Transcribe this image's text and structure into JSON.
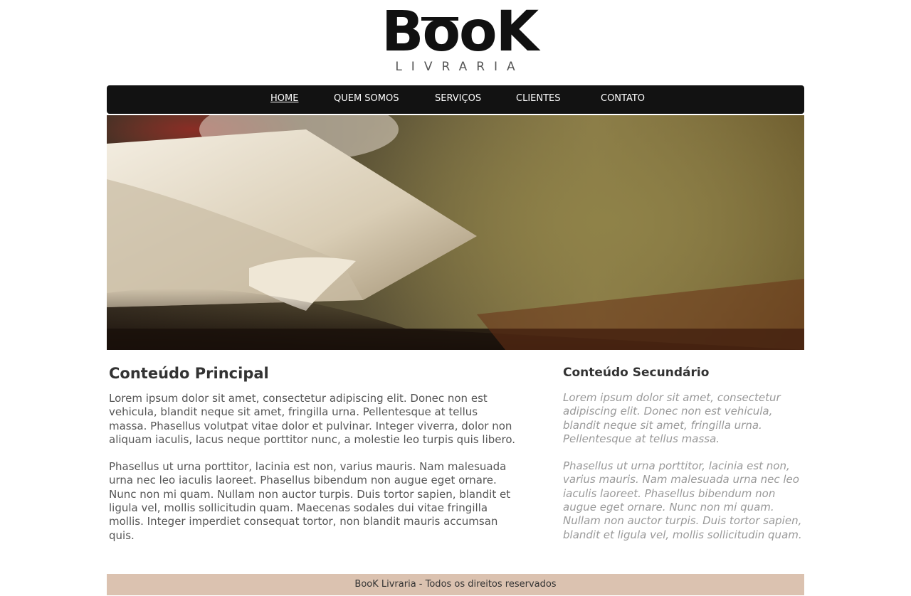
{
  "logo": {
    "word": "BooK",
    "sub": "LIVRARIA"
  },
  "nav": {
    "items": [
      {
        "label": "HOME"
      },
      {
        "label": "QUEM SOMOS"
      },
      {
        "label": "SERVIÇOS"
      },
      {
        "label": "CLIENTES"
      },
      {
        "label": "CONTATO"
      }
    ]
  },
  "main": {
    "title": "Conteúdo Principal",
    "paragraphs": [
      "Lorem ipsum dolor sit amet, consectetur adipiscing elit. Donec non est vehicula, blandit neque sit amet, fringilla urna. Pellentesque at tellus massa. Phasellus volutpat vitae dolor et pulvinar. Integer viverra, dolor non aliquam iaculis, lacus neque porttitor nunc, a molestie leo turpis quis libero.",
      "Phasellus ut urna porttitor, lacinia est non, varius mauris. Nam malesuada urna nec leo iaculis laoreet. Phasellus bibendum non augue eget ornare. Nunc non mi quam. Nullam non auctor turpis. Duis tortor sapien, blandit et ligula vel, mollis sollicitudin quam. Maecenas sodales dui vitae fringilla mollis. Integer imperdiet consequat tortor, non blandit mauris accumsan quis."
    ]
  },
  "side": {
    "title": "Conteúdo Secundário",
    "paragraphs": [
      "Lorem ipsum dolor sit amet, consectetur adipiscing elit. Donec non est vehicula, blandit neque sit amet, fringilla urna. Pellentesque at tellus massa.",
      "Phasellus ut urna porttitor, lacinia est non, varius mauris. Nam malesuada urna nec leo iaculis laoreet. Phasellus bibendum non augue eget ornare. Nunc non mi quam. Nullam non auctor turpis. Duis tortor sapien, blandit et ligula vel, mollis sollicitudin quam."
    ]
  },
  "footer": {
    "text": "BooK Livraria - Todos os direitos reservados"
  }
}
